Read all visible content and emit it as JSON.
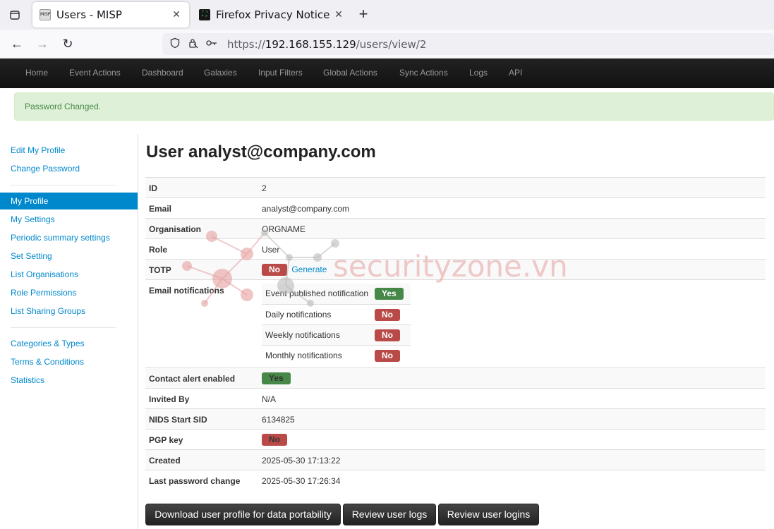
{
  "browser": {
    "tabs": [
      {
        "title": "Users - MISP",
        "active": true,
        "favicon": "misp-favicon"
      },
      {
        "title": "Firefox Privacy Notice —",
        "active": false,
        "favicon": "firefox-privacy-favicon"
      }
    ],
    "url_scheme": "https://",
    "url_host": "192.168.155.129",
    "url_path": "/users/view/2"
  },
  "topmenu": [
    "Home",
    "Event Actions",
    "Dashboard",
    "Galaxies",
    "Input Filters",
    "Global Actions",
    "Sync Actions",
    "Logs",
    "API"
  ],
  "alert": "Password Changed.",
  "sidenav": {
    "group1": [
      "Edit My Profile",
      "Change Password"
    ],
    "group2": [
      "My Profile",
      "My Settings",
      "Periodic summary settings",
      "Set Setting",
      "List Organisations",
      "Role Permissions",
      "List Sharing Groups"
    ],
    "group3": [
      "Categories & Types",
      "Terms & Conditions",
      "Statistics"
    ],
    "active": "My Profile"
  },
  "page_title": "User analyst@company.com",
  "fields": {
    "id": {
      "label": "ID",
      "value": "2"
    },
    "email": {
      "label": "Email",
      "value": "analyst@company.com"
    },
    "organisation": {
      "label": "Organisation",
      "value": "ORGNAME"
    },
    "role": {
      "label": "Role",
      "value": "User"
    },
    "totp": {
      "label": "TOTP",
      "badge": "No",
      "link": "Generate"
    },
    "email_notifications": {
      "label": "Email notifications",
      "items": [
        {
          "label": "Event published notification",
          "badge": "Yes"
        },
        {
          "label": "Daily notifications",
          "badge": "No"
        },
        {
          "label": "Weekly notifications",
          "badge": "No"
        },
        {
          "label": "Monthly notifications",
          "badge": "No"
        }
      ]
    },
    "contact_alert": {
      "label": "Contact alert enabled",
      "badge": "Yes"
    },
    "invited_by": {
      "label": "Invited By",
      "value": "N/A"
    },
    "nids": {
      "label": "NIDS Start SID",
      "value": "6134825"
    },
    "pgp": {
      "label": "PGP key",
      "badge": "No"
    },
    "created": {
      "label": "Created",
      "value": "2025-05-30 17:13:22"
    },
    "last_pw": {
      "label": "Last password change",
      "value": "2025-05-30 17:26:34"
    }
  },
  "buttons": {
    "download": "Download user profile for data portability",
    "logs": "Review user logs",
    "logins": "Review user logins"
  },
  "watermark": "securityzone.vn",
  "colors": {
    "link": "#0088cc",
    "no": "#b94a48",
    "yes": "#468847",
    "alert_bg": "#dff0d8"
  }
}
